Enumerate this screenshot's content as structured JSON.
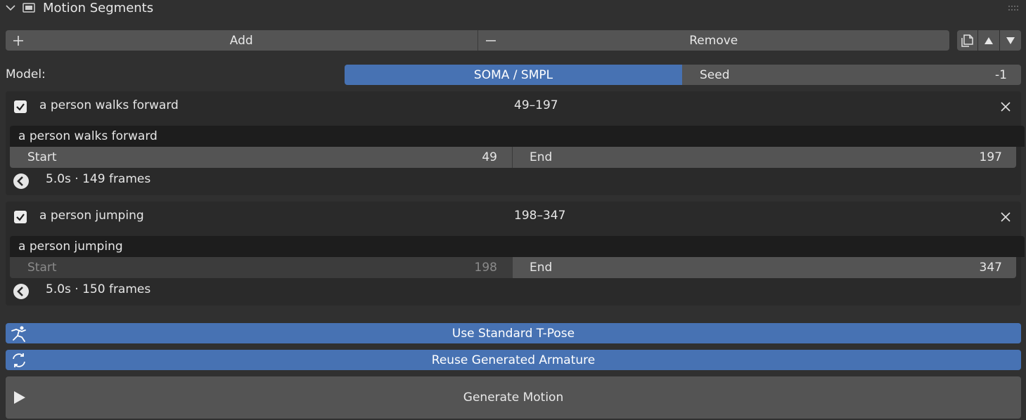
{
  "panel": {
    "title": "Motion Segments"
  },
  "toolbar": {
    "add_label": "Add",
    "remove_label": "Remove"
  },
  "model": {
    "label": "Model:",
    "value": "SOMA / SMPL",
    "seed_label": "Seed",
    "seed_value": "-1"
  },
  "segments": [
    {
      "title": "a person walks forward",
      "range": "49–197",
      "prompt": "a person walks forward",
      "start_label": "Start",
      "start_value": "49",
      "end_label": "End",
      "end_value": "197",
      "duration": "5.0s · 149 frames",
      "enabled": true
    },
    {
      "title": "a person jumping",
      "range": "198–347",
      "prompt": "a person jumping",
      "start_label": "Start",
      "start_value": "198",
      "end_label": "End",
      "end_value": "347",
      "duration": "5.0s · 150 frames",
      "enabled": true
    }
  ],
  "actions": {
    "tpose_label": "Use Standard T-Pose",
    "reuse_label": "Reuse Generated Armature",
    "generate_label": "Generate Motion"
  },
  "colors": {
    "accent": "#4772b3",
    "background": "#303030",
    "button": "#545454",
    "field": "#1d1d1d"
  }
}
